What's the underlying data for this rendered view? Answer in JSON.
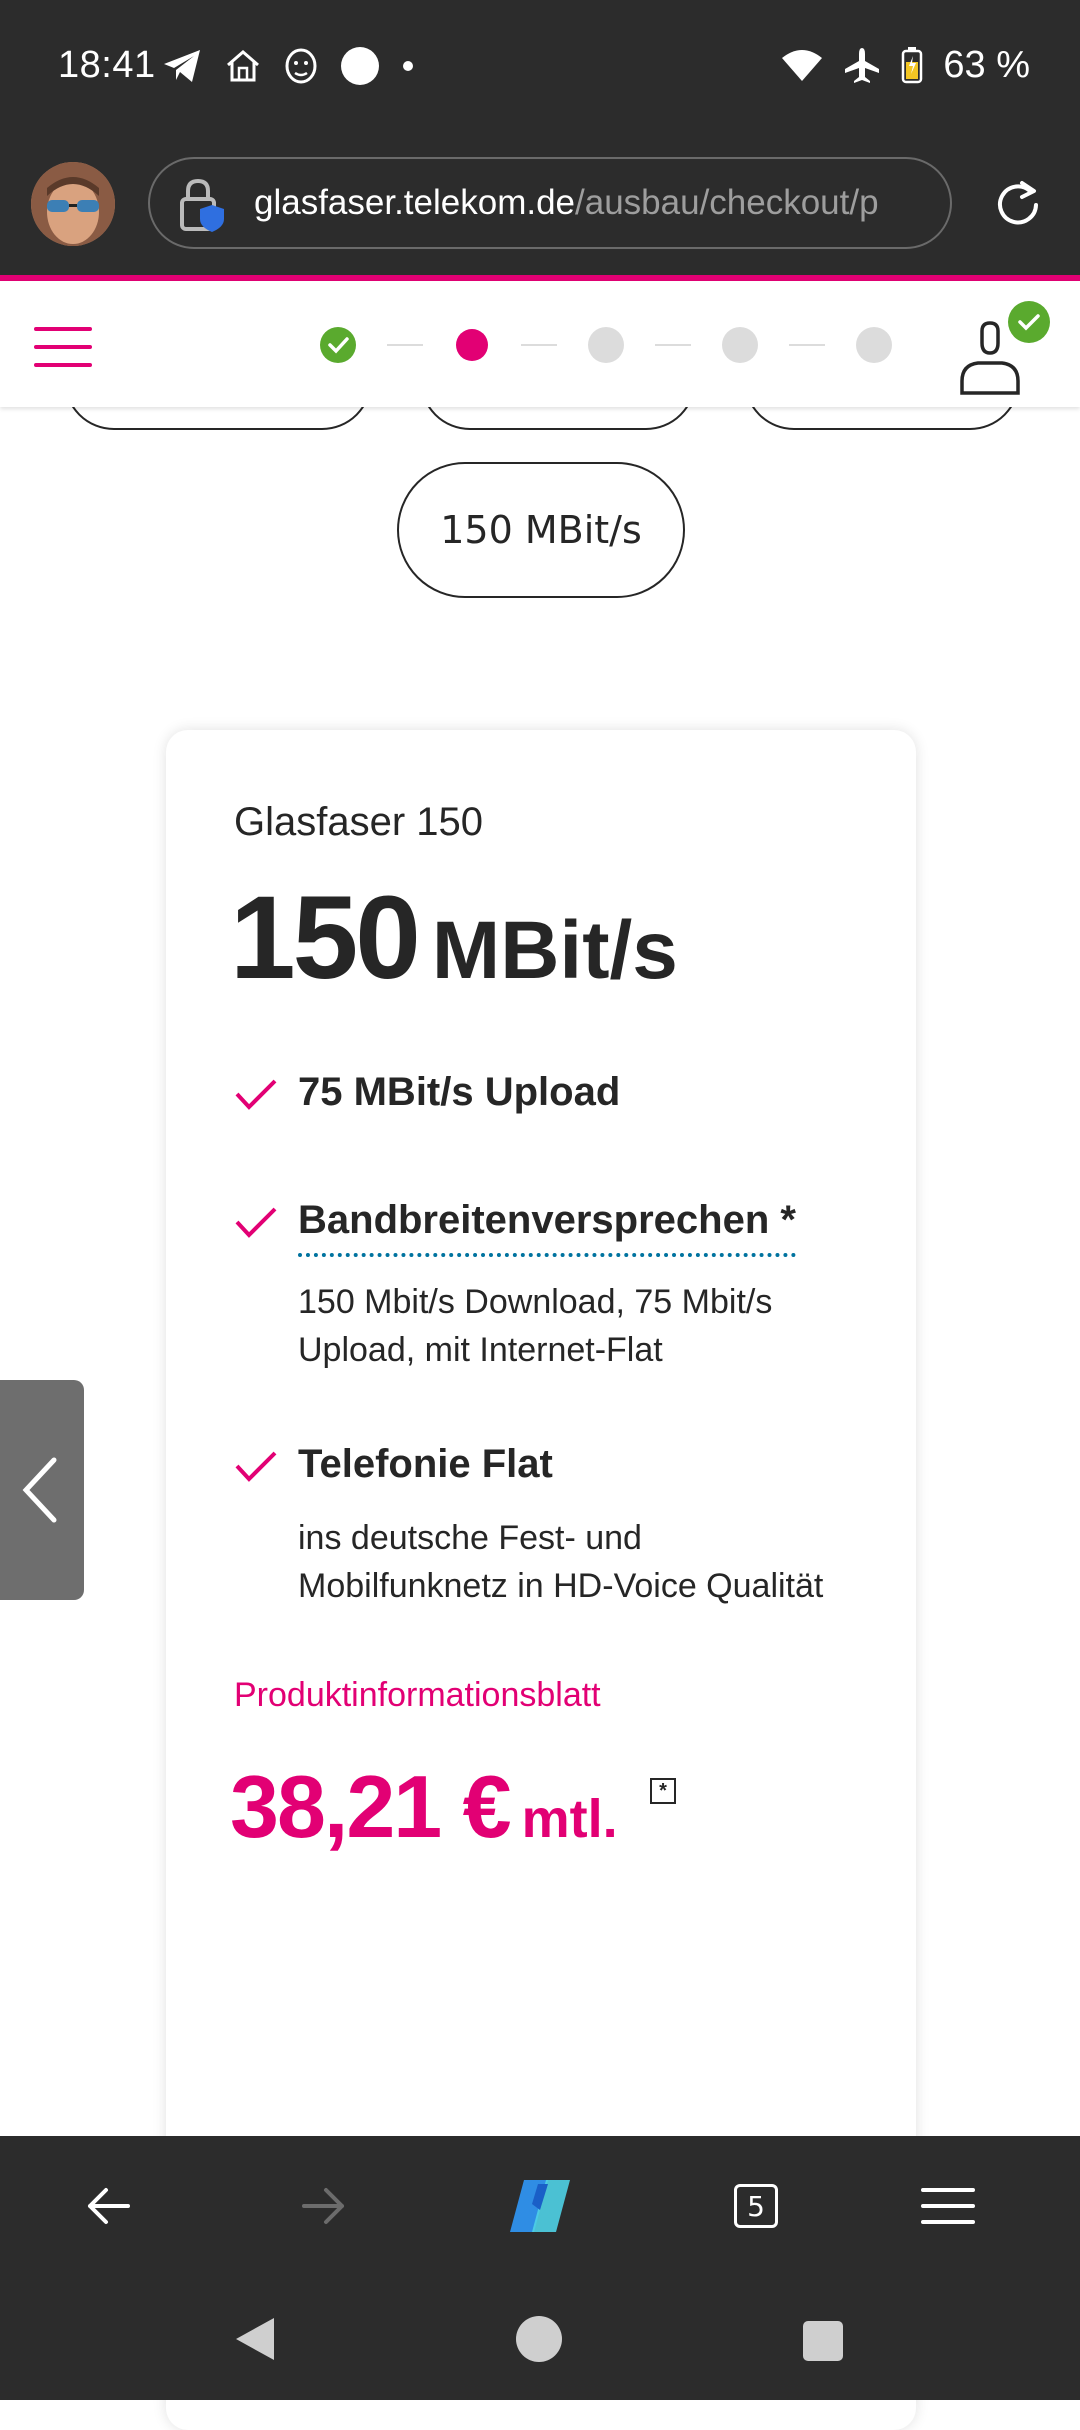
{
  "status_bar": {
    "time": "18:41",
    "battery": "63 %",
    "icons_left": [
      "telegram-icon",
      "home-icon",
      "lion-icon",
      "circle-icon",
      "dot-icon"
    ],
    "icons_right": [
      "wifi-icon",
      "airplane-icon",
      "battery-icon"
    ]
  },
  "browser": {
    "url_host": "glasfaser.telekom.de",
    "url_path": "/ausbau/checkout/p",
    "tab_count": "5"
  },
  "progress_steps": [
    "done",
    "active",
    "pending",
    "pending",
    "pending"
  ],
  "speed_options": {
    "selected_visible": "150 MBit/s"
  },
  "tariff": {
    "name": "Glasfaser 150",
    "speed_number": "150",
    "speed_unit": "MBit/s",
    "features": [
      {
        "title": "75 MBit/s Upload",
        "desc": ""
      },
      {
        "title": "Bandbreitenversprechen *",
        "desc": "150 Mbit/s Download, 75 Mbit/s Upload, mit Internet-Flat"
      },
      {
        "title": "Telefonie Flat",
        "desc": "ins deutsche Fest- und Mobilfunknetz in HD-Voice Qualität"
      }
    ],
    "info_link": "Produktinformationsblatt",
    "price_value": "38,21 €",
    "price_unit": "mtl.",
    "footnote_mark": "*"
  },
  "colors": {
    "magenta": "#e20074",
    "success": "#5aaa2e",
    "dark_chrome": "#2c2c2c"
  }
}
